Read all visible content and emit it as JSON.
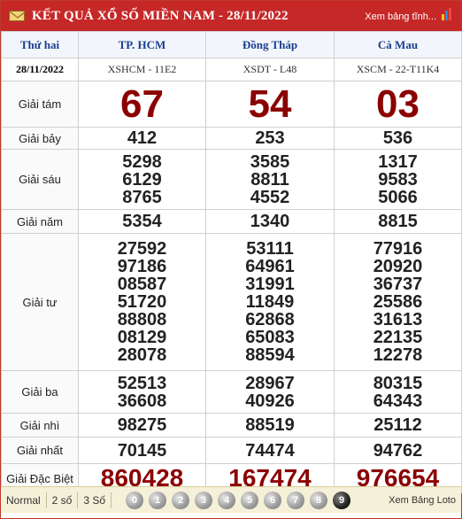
{
  "header": {
    "title": "KẾT QUẢ XỔ SỐ MIỀN NAM - 28/11/2022",
    "view_table": "Xem bảng tĩnh..."
  },
  "columns": {
    "day": "Thứ hai",
    "date": "28/11/2022",
    "provinces": [
      {
        "name": "TP. HCM",
        "code": "XSHCM - 11E2"
      },
      {
        "name": "Đồng Tháp",
        "code": "XSDT - L48"
      },
      {
        "name": "Cà Mau",
        "code": "XSCM - 22-T11K4"
      }
    ]
  },
  "prizes": [
    {
      "label": "Giải tám",
      "values": [
        [
          "67"
        ],
        [
          "54"
        ],
        [
          "03"
        ]
      ]
    },
    {
      "label": "Giải bảy",
      "values": [
        [
          "412"
        ],
        [
          "253"
        ],
        [
          "536"
        ]
      ]
    },
    {
      "label": "Giải sáu",
      "values": [
        [
          "5298",
          "6129",
          "8765"
        ],
        [
          "3585",
          "8811",
          "4552"
        ],
        [
          "1317",
          "9583",
          "5066"
        ]
      ]
    },
    {
      "label": "Giải năm",
      "values": [
        [
          "5354"
        ],
        [
          "1340"
        ],
        [
          "8815"
        ]
      ]
    },
    {
      "label": "Giải tư",
      "values": [
        [
          "27592",
          "97186",
          "08587",
          "51720",
          "88808",
          "08129",
          "28078"
        ],
        [
          "53111",
          "64961",
          "31991",
          "11849",
          "62868",
          "65083",
          "88594"
        ],
        [
          "77916",
          "20920",
          "36737",
          "25586",
          "31613",
          "22135",
          "12278"
        ]
      ]
    },
    {
      "label": "Giải ba",
      "values": [
        [
          "52513",
          "36608"
        ],
        [
          "28967",
          "40926"
        ],
        [
          "80315",
          "64343"
        ]
      ]
    },
    {
      "label": "Giải nhì",
      "values": [
        [
          "98275"
        ],
        [
          "88519"
        ],
        [
          "25112"
        ]
      ]
    },
    {
      "label": "Giải nhất",
      "values": [
        [
          "70145"
        ],
        [
          "74474"
        ],
        [
          "94762"
        ]
      ]
    },
    {
      "label": "Giải Đặc Biệt",
      "values": [
        [
          "860428"
        ],
        [
          "167474"
        ],
        [
          "976654"
        ]
      ]
    }
  ],
  "footer": {
    "modes": [
      "Normal",
      "2 số",
      "3 Số"
    ],
    "digits": [
      "0",
      "1",
      "2",
      "3",
      "4",
      "5",
      "6",
      "7",
      "8",
      "9"
    ],
    "loto_link": "Xem Bảng Loto"
  },
  "colors": {
    "header_bg": "#c62828",
    "prize_red": "#8b0000",
    "province_blue": "#1b3d8f"
  }
}
